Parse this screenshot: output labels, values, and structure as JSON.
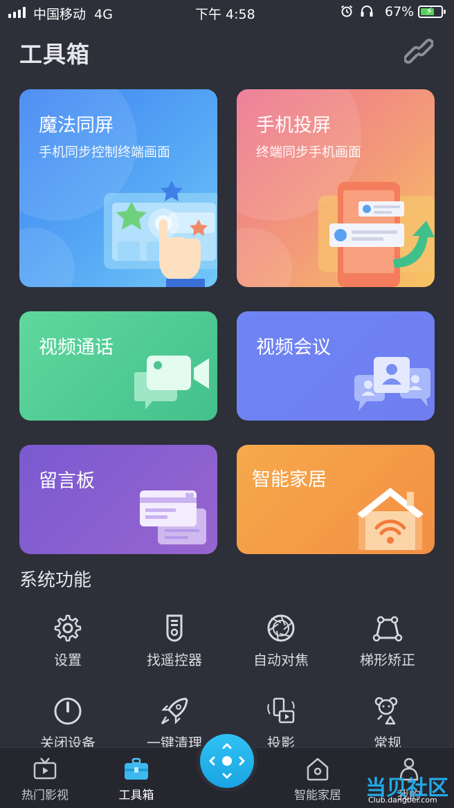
{
  "status_bar": {
    "carrier": "中国移动",
    "network": "4G",
    "time": "下午 4:58",
    "battery_percent": "67%",
    "battery_level": 0.67
  },
  "header": {
    "title": "工具箱"
  },
  "cards": [
    {
      "title": "魔法同屏",
      "subtitle": "手机同步控制终端画面"
    },
    {
      "title": "手机投屏",
      "subtitle": "终端同步手机画面"
    },
    {
      "title": "视频通话"
    },
    {
      "title": "视频会议"
    },
    {
      "title": "留言板"
    },
    {
      "title": "智能家居"
    }
  ],
  "system": {
    "title": "系统功能",
    "items": [
      {
        "label": "设置",
        "icon": "gear-icon"
      },
      {
        "label": "找遥控器",
        "icon": "remote-icon"
      },
      {
        "label": "自动对焦",
        "icon": "aperture-icon"
      },
      {
        "label": "梯形矫正",
        "icon": "keystone-icon"
      },
      {
        "label": "关闭设备",
        "icon": "power-icon"
      },
      {
        "label": "一键清理",
        "icon": "rocket-icon"
      },
      {
        "label": "投影",
        "icon": "projection-icon"
      },
      {
        "label": "常规",
        "icon": "bear-icon"
      }
    ]
  },
  "nav": {
    "items": [
      {
        "label": "热门影视",
        "icon": "tv-icon"
      },
      {
        "label": "工具箱",
        "icon": "toolbox-icon",
        "active": true
      },
      {
        "label": "智能家居",
        "icon": "home-icon"
      },
      {
        "label": "我的",
        "icon": "user-icon"
      }
    ],
    "center_icon": "remote-dpad-icon"
  },
  "watermark": {
    "text": "当贝社区",
    "sub": "Club.dangbei.com"
  },
  "colors": {
    "background": "#2d2f39",
    "accent": "#23a9e6"
  }
}
